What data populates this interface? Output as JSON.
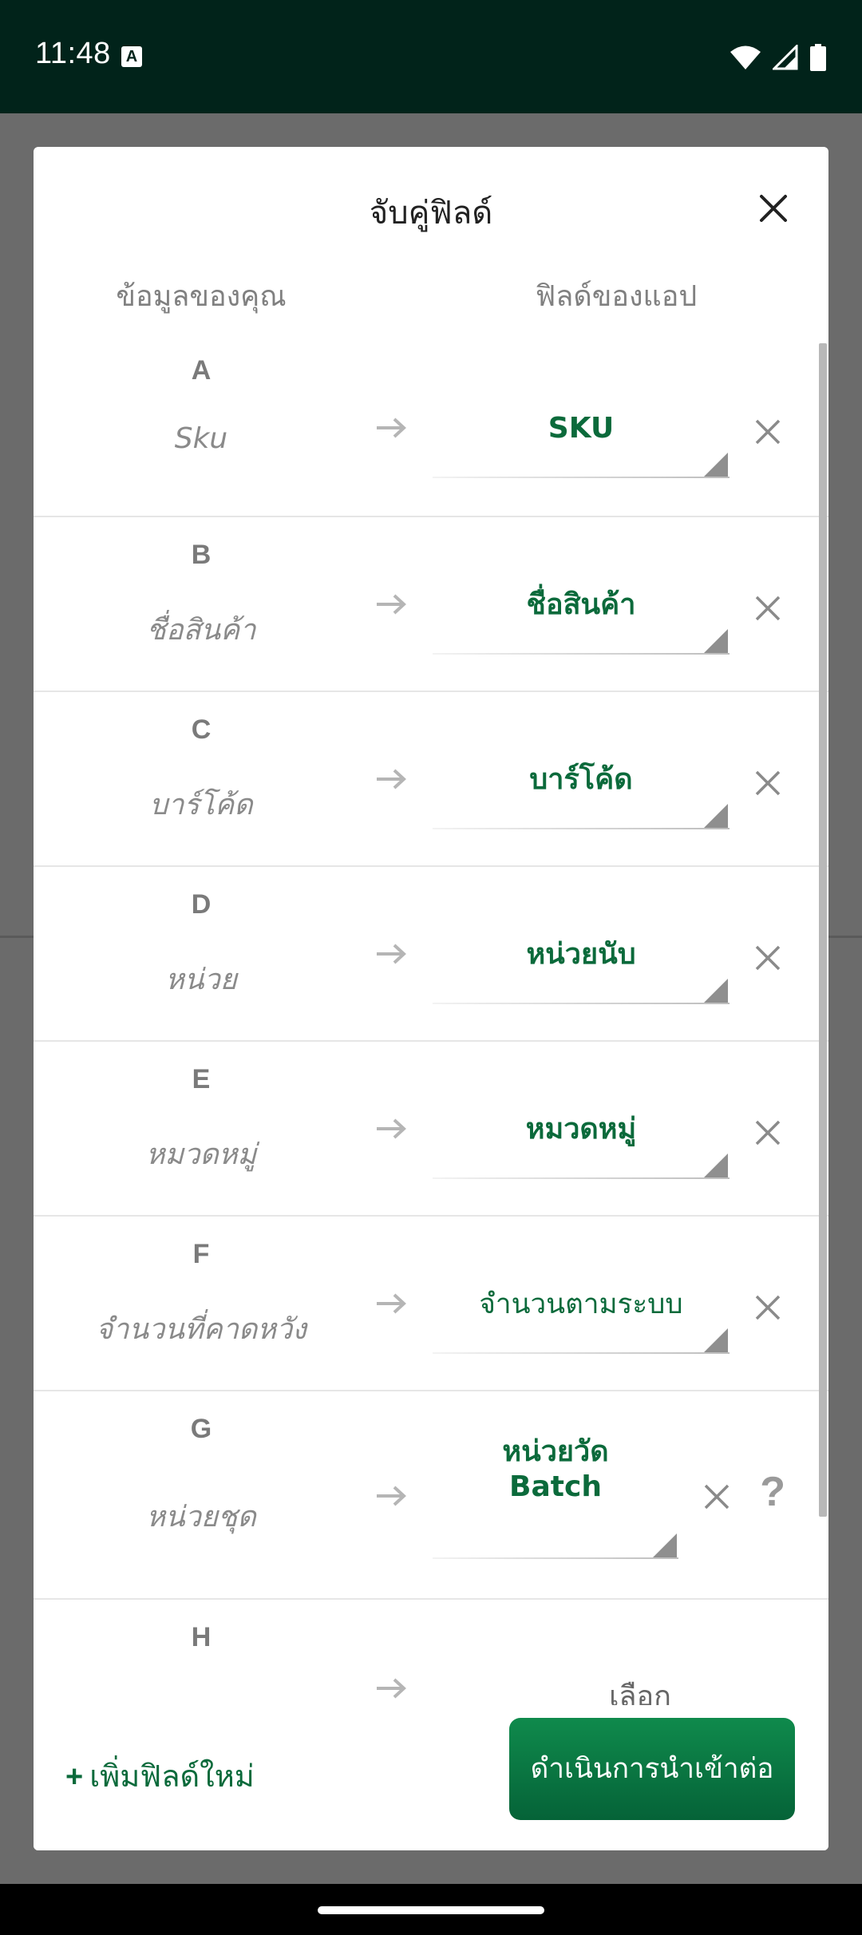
{
  "status_bar": {
    "time": "11:48",
    "icons": [
      "a-icon",
      "wifi-icon",
      "signal-icon",
      "battery-icon"
    ]
  },
  "dialog": {
    "title": "จับคู่ฟิลด์",
    "col_left_header": "ข้อมูลของคุณ",
    "col_right_header": "ฟิลด์ของแอป",
    "rows": [
      {
        "letter": "A",
        "source": "Sku",
        "target": "SKU"
      },
      {
        "letter": "B",
        "source": "ชื่อสินค้า",
        "target": "ชื่อสินค้า"
      },
      {
        "letter": "C",
        "source": "บาร์โค้ด",
        "target": "บาร์โค้ด"
      },
      {
        "letter": "D",
        "source": "หน่วย",
        "target": "หน่วยนับ"
      },
      {
        "letter": "E",
        "source": "หมวดหมู่",
        "target": "หมวดหมู่"
      },
      {
        "letter": "F",
        "source": "จำนวนที่คาดหวัง",
        "target": "จำนวนตามระบบ"
      },
      {
        "letter": "G",
        "source": "หน่วยชุด",
        "target_line1": "หน่วยวัด",
        "target_line2": "Batch",
        "help": "?"
      },
      {
        "letter": "H",
        "source": "",
        "placeholder": "เลือก"
      }
    ],
    "footer": {
      "add_field_plus": "+",
      "add_field_label": "เพิ่มฟิลด์ใหม่",
      "continue_label": "ดำเนินการนำเข้าต่อ"
    }
  },
  "colors": {
    "accent": "#0b6a3b",
    "status_bar_bg": "#01231a",
    "button_bg": "#0a7a42"
  }
}
